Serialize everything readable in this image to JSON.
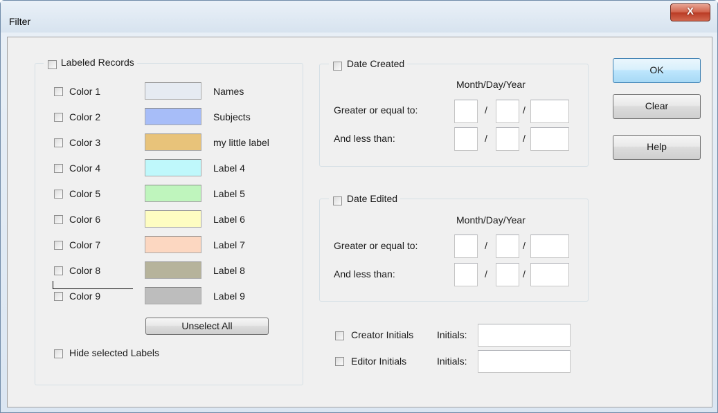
{
  "window": {
    "title": "Filter",
    "close_glyph": "X"
  },
  "labeled": {
    "title": "Labeled Records",
    "rows": [
      {
        "color_label": "Color 1",
        "swatch": "#e6ebf2",
        "name": "Names"
      },
      {
        "color_label": "Color 2",
        "swatch": "#a7bdf8",
        "name": "Subjects"
      },
      {
        "color_label": "Color 3",
        "swatch": "#e8c37a",
        "name": "my little label"
      },
      {
        "color_label": "Color 4",
        "swatch": "#bff8fb",
        "name": "Label 4"
      },
      {
        "color_label": "Color 5",
        "swatch": "#bff5bd",
        "name": "Label 5"
      },
      {
        "color_label": "Color 6",
        "swatch": "#fefdc2",
        "name": "Label 6"
      },
      {
        "color_label": "Color 7",
        "swatch": "#fcd7c1",
        "name": "Label 7"
      },
      {
        "color_label": "Color 8",
        "swatch": "#b6b39b",
        "name": "Label 8"
      },
      {
        "color_label": "Color 9",
        "swatch": "#bdbdbd",
        "name": "Label 9"
      }
    ],
    "unselect_all": "Unselect All",
    "hide_selected": "Hide selected Labels"
  },
  "date_created": {
    "title": "Date Created",
    "format": "Month/Day/Year",
    "greater_label": "Greater or equal to:",
    "less_label": "And less than:",
    "separator": "/"
  },
  "date_edited": {
    "title": "Date Edited",
    "format": "Month/Day/Year",
    "greater_label": "Greater or equal to:",
    "less_label": "And less than:",
    "separator": "/"
  },
  "initials": {
    "creator_label": "Creator Initials",
    "editor_label": "Editor Initials",
    "field_label": "Initials:",
    "creator_value": "",
    "editor_value": ""
  },
  "buttons": {
    "ok": "OK",
    "clear": "Clear",
    "help": "Help"
  }
}
